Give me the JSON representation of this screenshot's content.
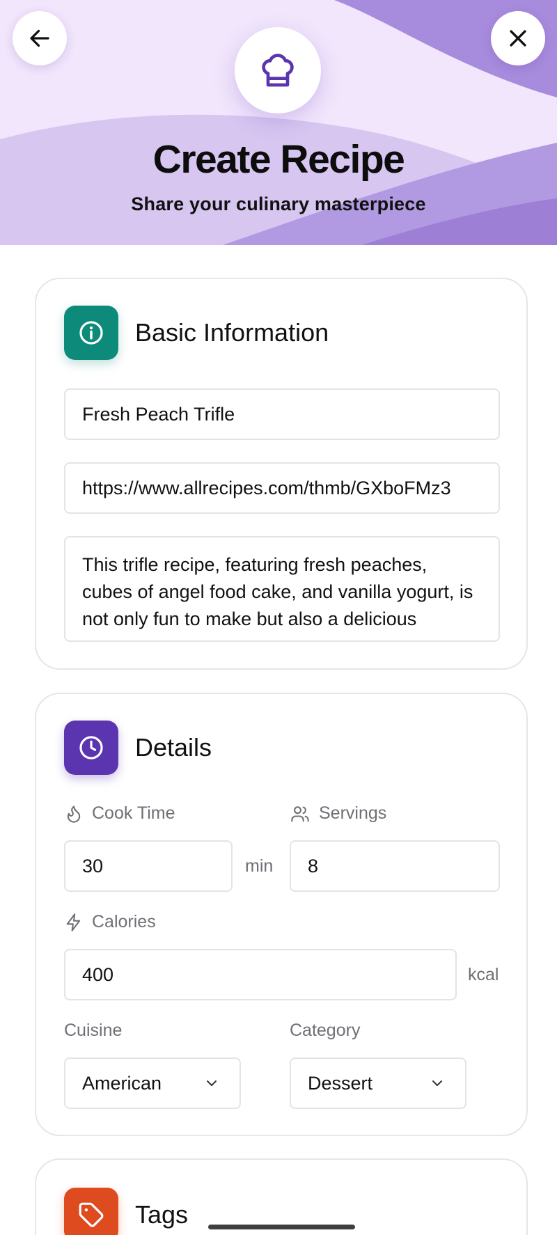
{
  "header": {
    "title": "Create Recipe",
    "subtitle": "Share your culinary masterpiece",
    "back_icon": "arrow-left-icon",
    "close_icon": "close-icon",
    "badge_icon": "chef-hat-icon"
  },
  "basic_info": {
    "title": "Basic Information",
    "icon": "info-icon",
    "recipe_name": "Fresh Peach Trifle",
    "image_url": "https://www.allrecipes.com/thmb/GXboFMz3",
    "description": "This trifle recipe, featuring fresh peaches, cubes of angel food cake, and vanilla yogurt, is not only fun to make but also a delicious"
  },
  "details": {
    "title": "Details",
    "icon": "clock-icon",
    "cook_time_label": "Cook Time",
    "cook_time_value": "30",
    "cook_time_unit": "min",
    "servings_label": "Servings",
    "servings_value": "8",
    "calories_label": "Calories",
    "calories_value": "400",
    "calories_unit": "kcal",
    "cuisine_label": "Cuisine",
    "cuisine_value": "American",
    "category_label": "Category",
    "category_value": "Dessert"
  },
  "tags": {
    "title": "Tags",
    "icon": "tag-icon"
  },
  "colors": {
    "brand_purple": "#5b35b0",
    "teal": "#0e8a7b",
    "orange": "#de4b1f",
    "hero_light": "#f1e6fc",
    "hero_mid": "#d4c2ef",
    "hero_dark": "#9a7ed6"
  }
}
